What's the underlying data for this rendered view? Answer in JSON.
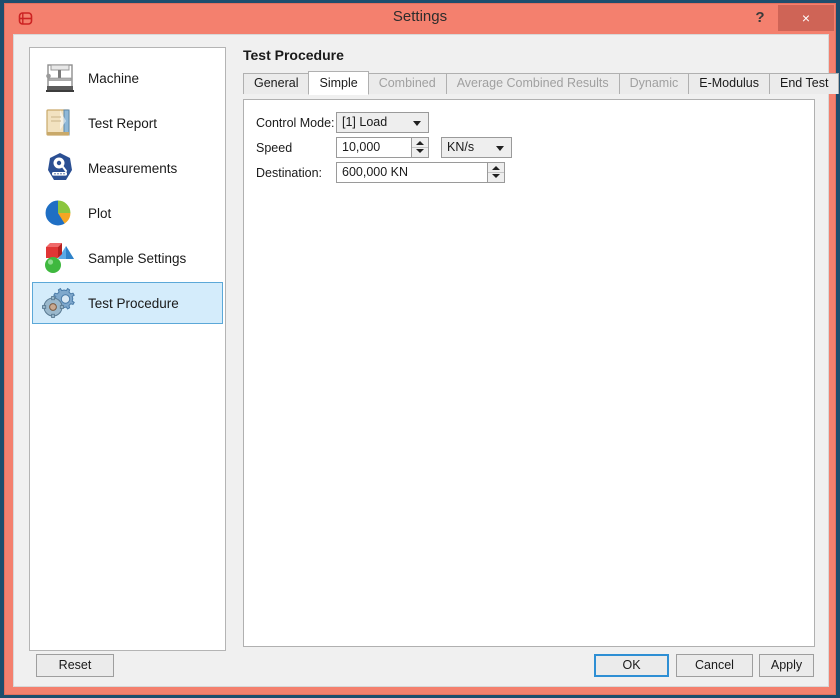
{
  "window": {
    "title": "Settings",
    "app_icon": "app-logo-icon",
    "help_label": "?",
    "close_label": "×",
    "titlebar_color": "#f4806e",
    "close_button_color": "#cf6456",
    "outer_border_color": "#1d4e6e"
  },
  "sidebar": {
    "items": [
      {
        "label": "Machine",
        "icon": "machine-icon",
        "selected": false
      },
      {
        "label": "Test Report",
        "icon": "report-book-icon",
        "selected": false
      },
      {
        "label": "Measurements",
        "icon": "gauge-icon",
        "selected": false
      },
      {
        "label": "Plot",
        "icon": "pie-chart-icon",
        "selected": false
      },
      {
        "label": "Sample Settings",
        "icon": "shapes-icon",
        "selected": false
      },
      {
        "label": "Test Procedure",
        "icon": "gears-icon",
        "selected": true
      }
    ],
    "selection_fill": "#d4ecfb",
    "selection_border": "#5ba8d8"
  },
  "main": {
    "page_title": "Test Procedure",
    "tabs": [
      {
        "label": "General",
        "state": "enabled"
      },
      {
        "label": "Simple",
        "state": "active"
      },
      {
        "label": "Combined",
        "state": "disabled"
      },
      {
        "label": "Average Combined Results",
        "state": "disabled"
      },
      {
        "label": "Dynamic",
        "state": "disabled"
      },
      {
        "label": "E-Modulus",
        "state": "enabled"
      },
      {
        "label": "End Test",
        "state": "enabled"
      }
    ],
    "form": {
      "control_mode": {
        "label": "Control Mode:",
        "value": "[1] Load"
      },
      "speed": {
        "label": "Speed",
        "value": "10,000",
        "unit": "KN/s"
      },
      "destination": {
        "label": "Destination:",
        "value": "600,000 KN"
      }
    }
  },
  "footer": {
    "reset": "Reset",
    "ok": "OK",
    "cancel": "Cancel",
    "apply": "Apply",
    "focus_color": "#2e8fd4"
  }
}
